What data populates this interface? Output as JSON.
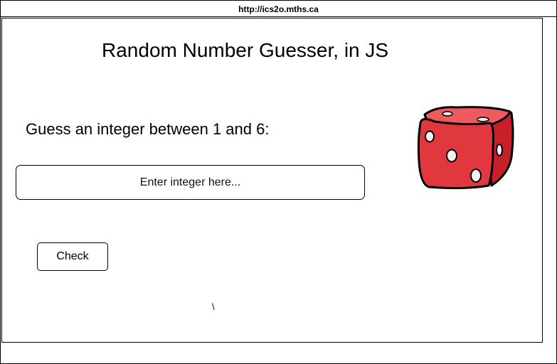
{
  "browser": {
    "url": "http://ics2o.mths.ca"
  },
  "page": {
    "title": "Random Number Guesser, in JS",
    "prompt": "Guess an integer between 1 and 6:",
    "input_placeholder": "Enter integer here...",
    "input_value": "",
    "check_label": "Check",
    "result_text": "\\"
  },
  "dice": {
    "icon": "dice-icon",
    "face_color": "#e0383e",
    "top_color": "#ef5a5e",
    "side_color": "#c8202a",
    "outline_color": "#000000"
  }
}
